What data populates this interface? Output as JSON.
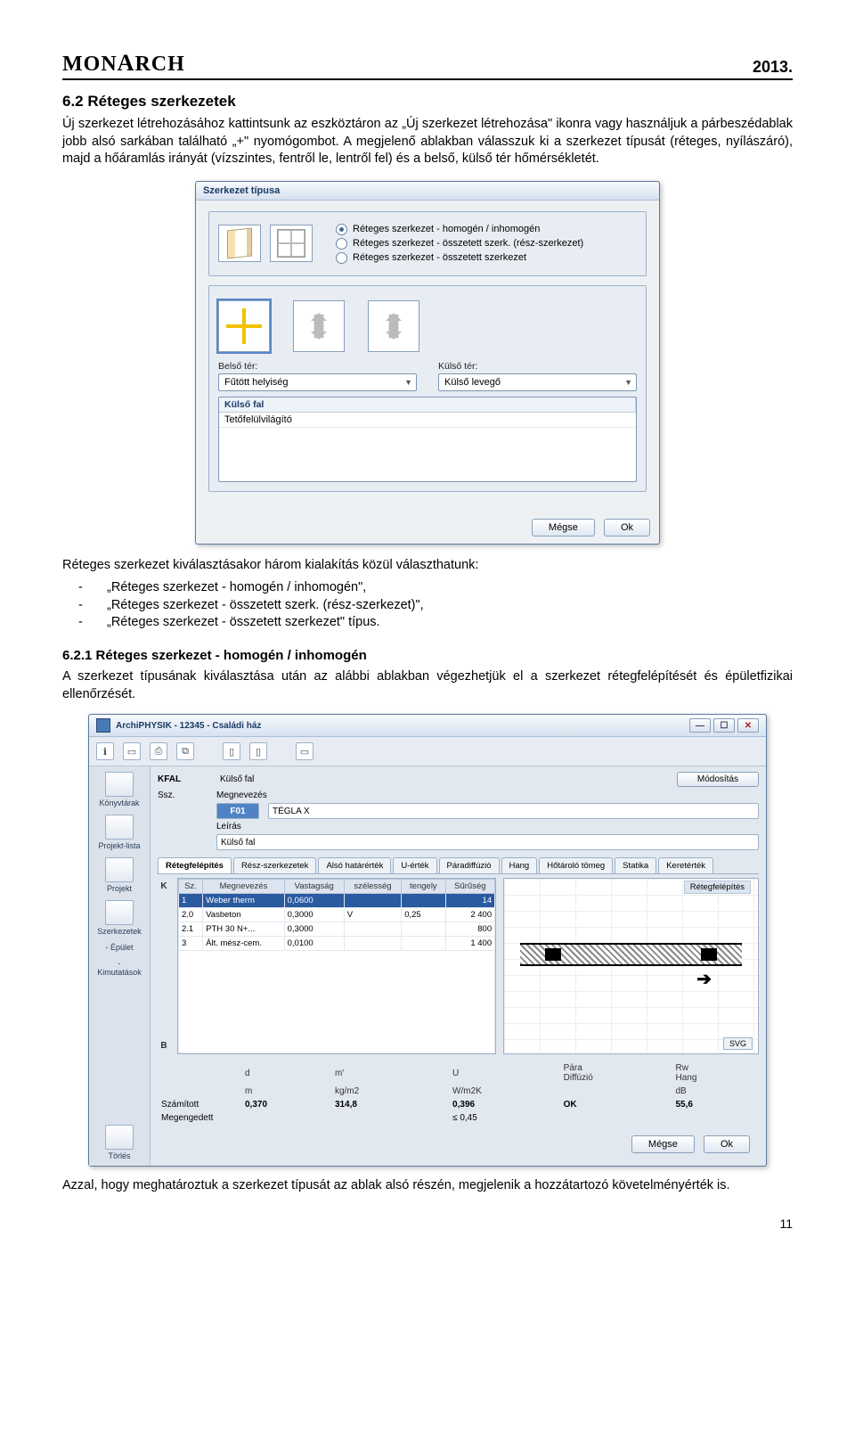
{
  "header": {
    "brand": "MONARCH",
    "year": "2013."
  },
  "section": {
    "h2": "6.2 Réteges szerkezetek",
    "p1": "Új szerkezet létrehozásához kattintsunk az eszköztáron az „Új szerkezet létrehozása\" ikonra vagy használjuk a párbeszédablak jobb alsó sarkában található „+\" nyomógombot. A megjelenő ablakban válasszuk ki a szerkezet típusát (réteges, nyílászáró), majd a hőáramlás irányát (vízszintes, fentről le, lentről fel) és a belső, külső tér hőmérsékletét.",
    "p2": "Réteges szerkezet kiválasztásakor három kialakítás közül választhatunk:",
    "li1": "„Réteges szerkezet - homogén / inhomogén\",",
    "li2": "„Réteges szerkezet - összetett szerk. (rész-szerkezet)\",",
    "li3": "„Réteges szerkezet - összetett szerkezet\" típus.",
    "h3": "6.2.1 Réteges szerkezet - homogén / inhomogén",
    "p3": "A szerkezet típusának kiválasztása után az alábbi ablakban végezhetjük el a szerkezet rétegfelépítését és épületfizikai ellenőrzését.",
    "p4": "Azzal, hogy meghatároztuk a szerkezet típusát az ablak alsó részén, megjelenik a hozzátartozó követelményérték is."
  },
  "dialog1": {
    "title": "Szerkezet típusa",
    "r1": "Réteges szerkezet - homogén / inhomogén",
    "r2": "Réteges szerkezet - összetett szerk. (rész-szerkezet)",
    "r3": "Réteges szerkezet - összetett szerkezet",
    "belso_lbl": "Belső tér:",
    "kulso_lbl": "Külső tér:",
    "belso_val": "Fűtött helyiség",
    "kulso_val": "Külső levegő",
    "list_h": "Külső fal",
    "list_r1": "Tetőfelülvilágító",
    "btn_cancel": "Mégse",
    "btn_ok": "Ok"
  },
  "app": {
    "title": "ArchiPHYSIK - 12345 - Családi ház",
    "win_min": "—",
    "win_max": "☐",
    "win_close": "✕",
    "sidebar": {
      "s1": "Könyvtárak",
      "s2": "Projekt-lista",
      "s3": "Projekt",
      "s4": "Szerkezetek",
      "s5": "- Épület",
      "s6": "- Kimutatások",
      "s7": "Törlés"
    },
    "top": {
      "kfal_lbl": "KFAL",
      "kfal_val": "Külső fal",
      "mod": "Módosítás",
      "ssz": "Ssz.",
      "f01": "F01",
      "megnevezes_lbl": "Megnevezés",
      "megnevezes_val": "TÉGLA X",
      "leiras_lbl": "Leírás",
      "leiras_val": "Külső fal"
    },
    "tabs": {
      "t1": "Rétegfelépítés",
      "t2": "Rész-szerkezetek",
      "t3": "Alsó határérték",
      "t4": "U-érték",
      "t5": "Páradiffúzió",
      "t6": "Hang",
      "t7": "Hőtároló tömeg",
      "t8": "Statika",
      "t9": "Keretérték"
    },
    "tbl": {
      "h1": "Sz.",
      "h2": "Megnevezés",
      "h3": "Vastagság",
      "h4": "szélesség",
      "h5": "tengely",
      "h6": "Sűrűség",
      "rows": [
        {
          "sz": "1",
          "n": "Weber therm",
          "v": "0,0600",
          "s": "",
          "t": "",
          "d": "14"
        },
        {
          "sz": "2.0",
          "n": "Vasbeton",
          "v": "0,3000",
          "s": "V",
          "t": "0,25",
          "d": "2 400"
        },
        {
          "sz": "2.1",
          "n": "PTH 30 N+...",
          "v": "0,3000",
          "s": "",
          "t": "",
          "d": "800"
        },
        {
          "sz": "3",
          "n": "Ált. mész-cem.",
          "v": "0,0100",
          "s": "",
          "t": "",
          "d": "1 400"
        }
      ],
      "preview_cap": "Rétegfelépítés",
      "svg": "SVG",
      "K": "K",
      "B": "B"
    },
    "summary": {
      "c_d": "d",
      "c_m": "m'",
      "c_u": "U",
      "c_para": "Pára\nDiffúzió",
      "c_rw": "Rw\nHang",
      "u_m": "m",
      "u_kg": "kg/m2",
      "u_w": "W/m2K",
      "u_db": "dB",
      "r1_lbl": "Számított",
      "r1_d": "0,370",
      "r1_m": "314,8",
      "r1_u": "0,396",
      "r1_p": "OK",
      "r1_rw": "55,6",
      "r2_lbl": "Megengedett",
      "r2_u": "≤ 0,45"
    }
  },
  "pagenum": "11"
}
